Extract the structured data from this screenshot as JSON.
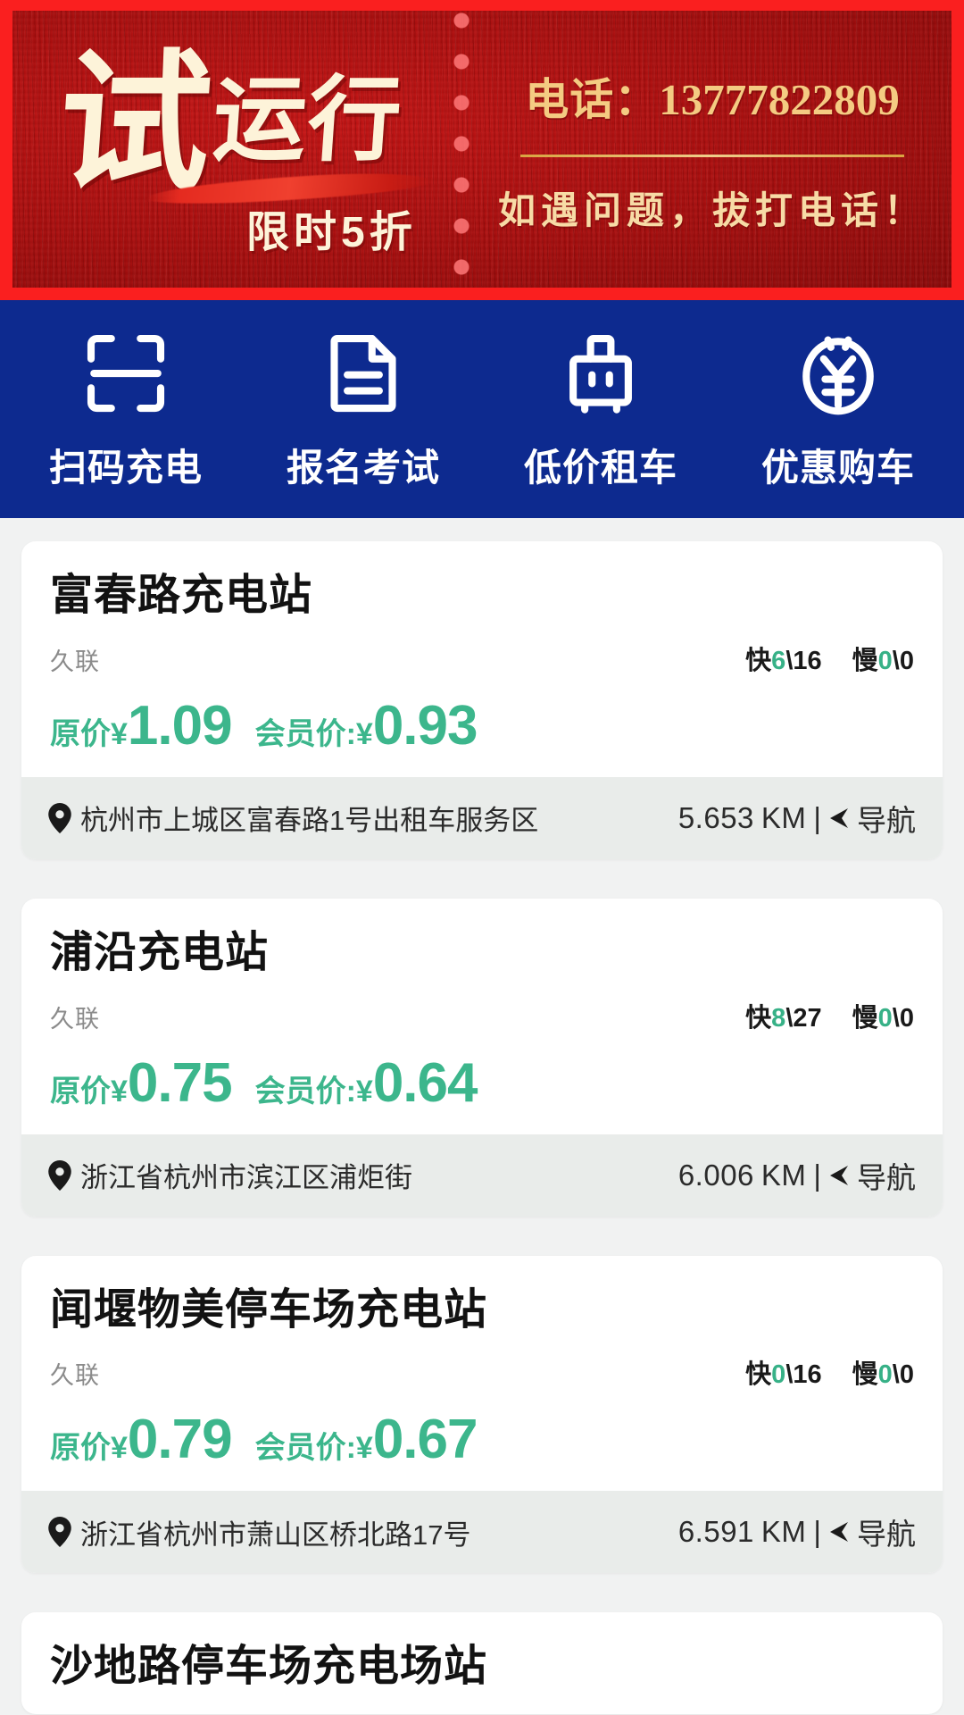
{
  "banner": {
    "headline_big": "试",
    "headline_rest": "运行",
    "subline": "限时5折",
    "phone_label": "电话：",
    "phone_number": "13777822809",
    "help_text": "如遇问题，拔打电话！",
    "bg_color": "#a80d0d",
    "frame_color": "#fa1f1f",
    "gold_color": "#f4cb82"
  },
  "quicknav": {
    "bg_color": "#0d2a8f",
    "items": [
      {
        "icon": "scan-qr-icon",
        "label": "扫码充电"
      },
      {
        "icon": "document-icon",
        "label": "报名考试"
      },
      {
        "icon": "suitcase-icon",
        "label": "低价租车"
      },
      {
        "icon": "yen-badge-icon",
        "label": "优惠购车"
      }
    ]
  },
  "list": {
    "price_color": "#3cb68c",
    "labels": {
      "fast": "快",
      "slow": "慢",
      "original_price": "原价¥",
      "member_price": "会员价:¥",
      "distance_unit": "KM",
      "separator": "|",
      "navigate": "导航"
    },
    "stations": [
      {
        "name": "富春路充电站",
        "operator": "久联",
        "fast_available": "6",
        "fast_total": "16",
        "slow_available": "0",
        "slow_total": "0",
        "price_original": "1.09",
        "price_member": "0.93",
        "address": "杭州市上城区富春路1号出租车服务区",
        "distance": "5.653"
      },
      {
        "name": "浦沿充电站",
        "operator": "久联",
        "fast_available": "8",
        "fast_total": "27",
        "slow_available": "0",
        "slow_total": "0",
        "price_original": "0.75",
        "price_member": "0.64",
        "address": "浙江省杭州市滨江区浦炬街",
        "distance": "6.006"
      },
      {
        "name": "闻堰物美停车场充电站",
        "operator": "久联",
        "fast_available": "0",
        "fast_total": "16",
        "slow_available": "0",
        "slow_total": "0",
        "price_original": "0.79",
        "price_member": "0.67",
        "address": "浙江省杭州市萧山区桥北路17号",
        "distance": "6.591"
      },
      {
        "name": "沙地路停车场充电场站",
        "operator": "",
        "fast_available": "",
        "fast_total": "",
        "slow_available": "",
        "slow_total": "",
        "price_original": "",
        "price_member": "",
        "address": "",
        "distance": ""
      }
    ]
  }
}
